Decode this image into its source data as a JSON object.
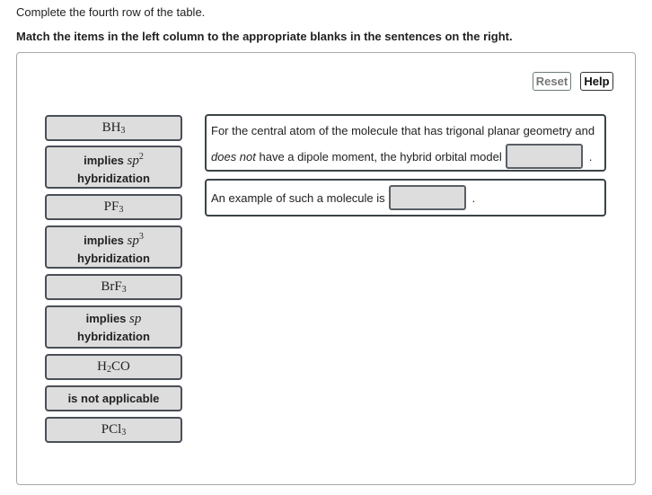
{
  "instructions": {
    "line1": "Complete the fourth row of the table.",
    "line2": "Match the items in the left column to the appropriate blanks in the sentences on the right."
  },
  "toolbar": {
    "reset_label": "Reset",
    "help_label": "Help"
  },
  "tiles": [
    {
      "type": "chem",
      "main": "BH",
      "sub": "3"
    },
    {
      "type": "text",
      "prefix": "implies ",
      "italic": "sp",
      "sup": "2",
      "line2": "hybridization"
    },
    {
      "type": "chem",
      "main": "PF",
      "sub": "3"
    },
    {
      "type": "text",
      "prefix": "implies ",
      "italic": "sp",
      "sup": "3",
      "line2": "hybridization"
    },
    {
      "type": "chem",
      "main": "BrF",
      "sub": "3"
    },
    {
      "type": "text",
      "prefix": "implies ",
      "italic": "sp",
      "sup": "",
      "line2": "hybridization"
    },
    {
      "type": "chem",
      "main": "H",
      "sub": "2",
      "rest": "CO"
    },
    {
      "type": "plain",
      "label": "is not applicable"
    },
    {
      "type": "chem",
      "main": "PCl",
      "sub": "3"
    }
  ],
  "sentences": {
    "s1_line1": "For the central atom of the molecule that has trigonal planar geometry and",
    "s1_line2_italic": "does not",
    "s1_line2_rest": " have a dipole moment, the hybrid orbital model",
    "s1_end": ".",
    "s2_text": "An example of such a molecule is",
    "s2_end": "."
  }
}
